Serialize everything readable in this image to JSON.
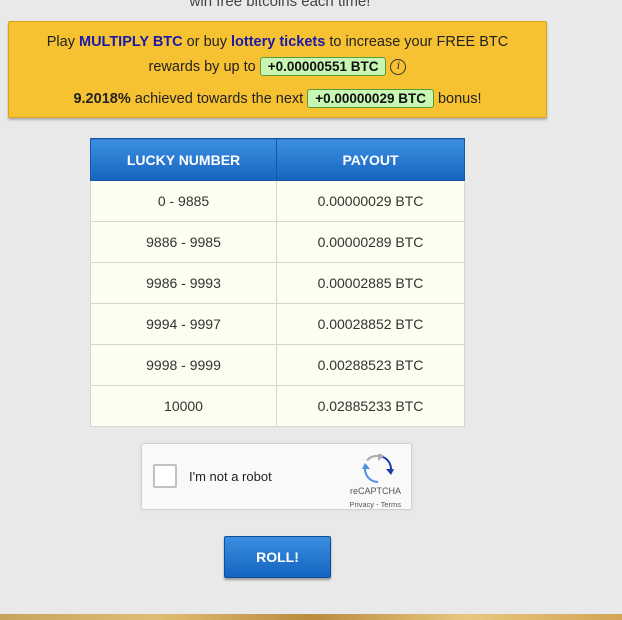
{
  "header": {
    "cut_text": "win free bitcoins each time!"
  },
  "banner": {
    "play": "Play",
    "multiply_link": "MULTIPLY BTC",
    "or_buy": "or buy",
    "lottery_link": "lottery tickets",
    "increase": "to increase your FREE BTC",
    "rewards": "rewards by up to",
    "rewards_amount": "+0.00000551 BTC",
    "info_icon": "i",
    "achieved_pct": "9.2018%",
    "achieved_text": "achieved towards the next",
    "bonus_amount": "+0.00000029 BTC",
    "bonus_word": "bonus!"
  },
  "table": {
    "headers": [
      "LUCKY NUMBER",
      "PAYOUT"
    ],
    "rows": [
      [
        "0 - 9885",
        "0.00000029 BTC"
      ],
      [
        "9886 - 9985",
        "0.00000289 BTC"
      ],
      [
        "9986 - 9993",
        "0.00002885 BTC"
      ],
      [
        "9994 - 9997",
        "0.00028852 BTC"
      ],
      [
        "9998 - 9999",
        "0.00288523 BTC"
      ],
      [
        "10000",
        "0.02885233 BTC"
      ]
    ]
  },
  "captcha": {
    "label": "I'm not a robot",
    "brand": "reCAPTCHA",
    "links": "Privacy - Terms"
  },
  "roll_button": {
    "label": "ROLL!"
  },
  "colors": {
    "banner": "#f7c232",
    "accent_blue": "#1565c0",
    "pill_green": "#c7f7b3"
  }
}
